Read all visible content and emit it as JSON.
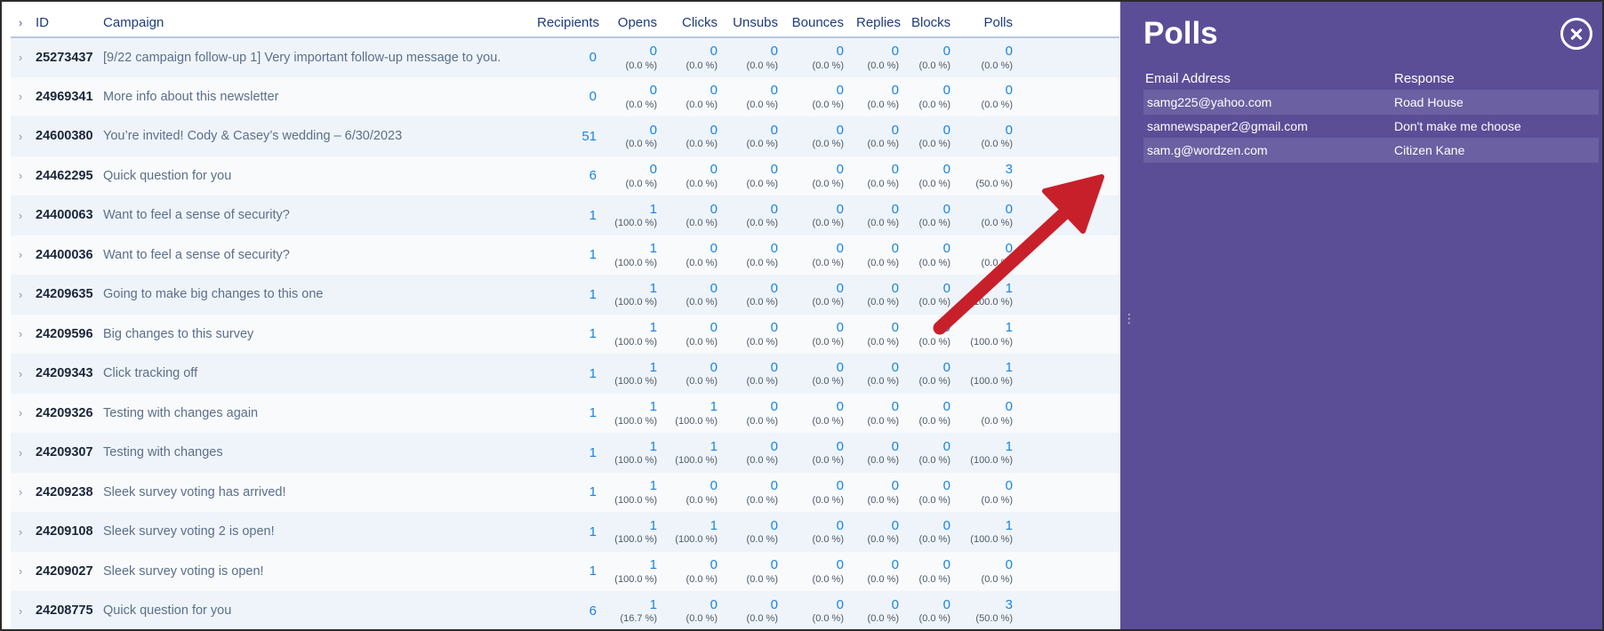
{
  "table": {
    "headers": {
      "id": "ID",
      "campaign": "Campaign",
      "recipients": "Recipients",
      "opens": "Opens",
      "clicks": "Clicks",
      "unsubs": "Unsubs",
      "bounces": "Bounces",
      "replies": "Replies",
      "blocks": "Blocks",
      "polls": "Polls"
    },
    "rows": [
      {
        "id": "25273437",
        "campaign": "[9/22 campaign follow-up 1] Very important follow-up message to you.",
        "recipients": "0",
        "opens": [
          "0",
          "(0.0 %)"
        ],
        "clicks": [
          "0",
          "(0.0 %)"
        ],
        "unsubs": [
          "0",
          "(0.0 %)"
        ],
        "bounces": [
          "0",
          "(0.0 %)"
        ],
        "replies": [
          "0",
          "(0.0 %)"
        ],
        "blocks": [
          "0",
          "(0.0 %)"
        ],
        "polls": [
          "0",
          "(0.0 %)"
        ]
      },
      {
        "id": "24969341",
        "campaign": "More info about this newsletter",
        "recipients": "0",
        "opens": [
          "0",
          "(0.0 %)"
        ],
        "clicks": [
          "0",
          "(0.0 %)"
        ],
        "unsubs": [
          "0",
          "(0.0 %)"
        ],
        "bounces": [
          "0",
          "(0.0 %)"
        ],
        "replies": [
          "0",
          "(0.0 %)"
        ],
        "blocks": [
          "0",
          "(0.0 %)"
        ],
        "polls": [
          "0",
          "(0.0 %)"
        ]
      },
      {
        "id": "24600380",
        "campaign": "You’re invited! Cody & Casey’s wedding – 6/30/2023",
        "recipients": "51",
        "opens": [
          "0",
          "(0.0 %)"
        ],
        "clicks": [
          "0",
          "(0.0 %)"
        ],
        "unsubs": [
          "0",
          "(0.0 %)"
        ],
        "bounces": [
          "0",
          "(0.0 %)"
        ],
        "replies": [
          "0",
          "(0.0 %)"
        ],
        "blocks": [
          "0",
          "(0.0 %)"
        ],
        "polls": [
          "0",
          "(0.0 %)"
        ]
      },
      {
        "id": "24462295",
        "campaign": "Quick question for you",
        "recipients": "6",
        "opens": [
          "0",
          "(0.0 %)"
        ],
        "clicks": [
          "0",
          "(0.0 %)"
        ],
        "unsubs": [
          "0",
          "(0.0 %)"
        ],
        "bounces": [
          "0",
          "(0.0 %)"
        ],
        "replies": [
          "0",
          "(0.0 %)"
        ],
        "blocks": [
          "0",
          "(0.0 %)"
        ],
        "polls": [
          "3",
          "(50.0 %)"
        ]
      },
      {
        "id": "24400063",
        "campaign": "Want to feel a sense of security?",
        "recipients": "1",
        "opens": [
          "1",
          "(100.0 %)"
        ],
        "clicks": [
          "0",
          "(0.0 %)"
        ],
        "unsubs": [
          "0",
          "(0.0 %)"
        ],
        "bounces": [
          "0",
          "(0.0 %)"
        ],
        "replies": [
          "0",
          "(0.0 %)"
        ],
        "blocks": [
          "0",
          "(0.0 %)"
        ],
        "polls": [
          "0",
          "(0.0 %)"
        ]
      },
      {
        "id": "24400036",
        "campaign": "Want to feel a sense of security?",
        "recipients": "1",
        "opens": [
          "1",
          "(100.0 %)"
        ],
        "clicks": [
          "0",
          "(0.0 %)"
        ],
        "unsubs": [
          "0",
          "(0.0 %)"
        ],
        "bounces": [
          "0",
          "(0.0 %)"
        ],
        "replies": [
          "0",
          "(0.0 %)"
        ],
        "blocks": [
          "0",
          "(0.0 %)"
        ],
        "polls": [
          "0",
          "(0.0 %)"
        ]
      },
      {
        "id": "24209635",
        "campaign": "Going to make big changes to this one",
        "recipients": "1",
        "opens": [
          "1",
          "(100.0 %)"
        ],
        "clicks": [
          "0",
          "(0.0 %)"
        ],
        "unsubs": [
          "0",
          "(0.0 %)"
        ],
        "bounces": [
          "0",
          "(0.0 %)"
        ],
        "replies": [
          "0",
          "(0.0 %)"
        ],
        "blocks": [
          "0",
          "(0.0 %)"
        ],
        "polls": [
          "1",
          "(100.0 %)"
        ]
      },
      {
        "id": "24209596",
        "campaign": "Big changes to this survey",
        "recipients": "1",
        "opens": [
          "1",
          "(100.0 %)"
        ],
        "clicks": [
          "0",
          "(0.0 %)"
        ],
        "unsubs": [
          "0",
          "(0.0 %)"
        ],
        "bounces": [
          "0",
          "(0.0 %)"
        ],
        "replies": [
          "0",
          "(0.0 %)"
        ],
        "blocks": [
          "0",
          "(0.0 %)"
        ],
        "polls": [
          "1",
          "(100.0 %)"
        ]
      },
      {
        "id": "24209343",
        "campaign": "Click tracking off",
        "recipients": "1",
        "opens": [
          "1",
          "(100.0 %)"
        ],
        "clicks": [
          "0",
          "(0.0 %)"
        ],
        "unsubs": [
          "0",
          "(0.0 %)"
        ],
        "bounces": [
          "0",
          "(0.0 %)"
        ],
        "replies": [
          "0",
          "(0.0 %)"
        ],
        "blocks": [
          "0",
          "(0.0 %)"
        ],
        "polls": [
          "1",
          "(100.0 %)"
        ]
      },
      {
        "id": "24209326",
        "campaign": "Testing with changes again",
        "recipients": "1",
        "opens": [
          "1",
          "(100.0 %)"
        ],
        "clicks": [
          "1",
          "(100.0 %)"
        ],
        "unsubs": [
          "0",
          "(0.0 %)"
        ],
        "bounces": [
          "0",
          "(0.0 %)"
        ],
        "replies": [
          "0",
          "(0.0 %)"
        ],
        "blocks": [
          "0",
          "(0.0 %)"
        ],
        "polls": [
          "0",
          "(0.0 %)"
        ]
      },
      {
        "id": "24209307",
        "campaign": "Testing with changes",
        "recipients": "1",
        "opens": [
          "1",
          "(100.0 %)"
        ],
        "clicks": [
          "1",
          "(100.0 %)"
        ],
        "unsubs": [
          "0",
          "(0.0 %)"
        ],
        "bounces": [
          "0",
          "(0.0 %)"
        ],
        "replies": [
          "0",
          "(0.0 %)"
        ],
        "blocks": [
          "0",
          "(0.0 %)"
        ],
        "polls": [
          "1",
          "(100.0 %)"
        ]
      },
      {
        "id": "24209238",
        "campaign": "Sleek survey voting has arrived!",
        "recipients": "1",
        "opens": [
          "1",
          "(100.0 %)"
        ],
        "clicks": [
          "0",
          "(0.0 %)"
        ],
        "unsubs": [
          "0",
          "(0.0 %)"
        ],
        "bounces": [
          "0",
          "(0.0 %)"
        ],
        "replies": [
          "0",
          "(0.0 %)"
        ],
        "blocks": [
          "0",
          "(0.0 %)"
        ],
        "polls": [
          "0",
          "(0.0 %)"
        ]
      },
      {
        "id": "24209108",
        "campaign": "Sleek survey voting 2 is open!",
        "recipients": "1",
        "opens": [
          "1",
          "(100.0 %)"
        ],
        "clicks": [
          "1",
          "(100.0 %)"
        ],
        "unsubs": [
          "0",
          "(0.0 %)"
        ],
        "bounces": [
          "0",
          "(0.0 %)"
        ],
        "replies": [
          "0",
          "(0.0 %)"
        ],
        "blocks": [
          "0",
          "(0.0 %)"
        ],
        "polls": [
          "1",
          "(100.0 %)"
        ]
      },
      {
        "id": "24209027",
        "campaign": "Sleek survey voting is open!",
        "recipients": "1",
        "opens": [
          "1",
          "(100.0 %)"
        ],
        "clicks": [
          "0",
          "(0.0 %)"
        ],
        "unsubs": [
          "0",
          "(0.0 %)"
        ],
        "bounces": [
          "0",
          "(0.0 %)"
        ],
        "replies": [
          "0",
          "(0.0 %)"
        ],
        "blocks": [
          "0",
          "(0.0 %)"
        ],
        "polls": [
          "0",
          "(0.0 %)"
        ]
      },
      {
        "id": "24208775",
        "campaign": "Quick question for you",
        "recipients": "6",
        "opens": [
          "1",
          "(16.7 %)"
        ],
        "clicks": [
          "0",
          "(0.0 %)"
        ],
        "unsubs": [
          "0",
          "(0.0 %)"
        ],
        "bounces": [
          "0",
          "(0.0 %)"
        ],
        "replies": [
          "0",
          "(0.0 %)"
        ],
        "blocks": [
          "0",
          "(0.0 %)"
        ],
        "polls": [
          "3",
          "(50.0 %)"
        ]
      }
    ]
  },
  "panel": {
    "title": "Polls",
    "close_icon": "close-circle-icon",
    "columns": {
      "email": "Email Address",
      "response": "Response"
    },
    "responses": [
      {
        "email": "samg225@yahoo.com",
        "response": "Road House"
      },
      {
        "email": "samnewspaper2@gmail.com",
        "response": "Don't make me choose"
      },
      {
        "email": "sam.g@wordzen.com",
        "response": "Citizen Kane"
      }
    ]
  },
  "colors": {
    "panel_bg": "#5b4e97",
    "link_blue": "#1a84e0",
    "header_text": "#1f3b7a",
    "arrow_red": "#c8202a"
  },
  "icons": {
    "row_expand": "chevron-right-icon",
    "annotation": "red-arrow-annotation"
  }
}
